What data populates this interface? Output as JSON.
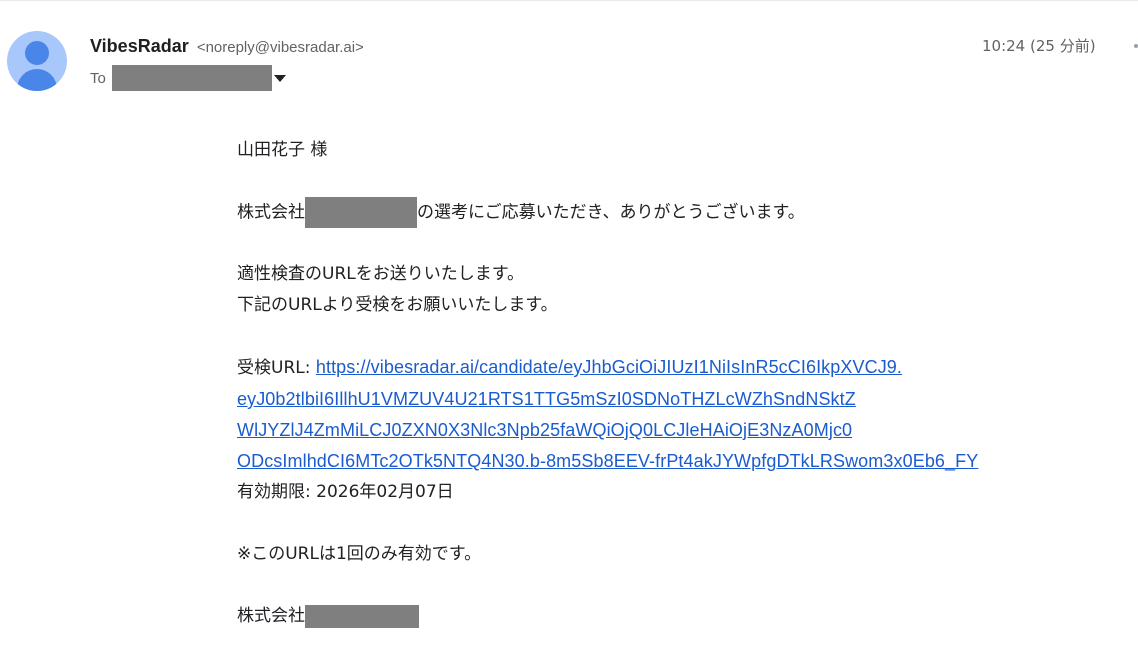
{
  "email": {
    "sender_name": "VibesRadar",
    "sender_email": "<noreply@vibesradar.ai>",
    "timestamp": "10:24 (25 分前)",
    "to_label": "To"
  },
  "body": {
    "greeting": "山田花子 様",
    "thanks_prefix": "株式会社",
    "thanks_suffix": "の選考にご応募いただき、ありがとうございます。",
    "line_url_send": "適性検査のURLをお送りいたします。",
    "line_request": "下記のURLより受検をお願いいたします。",
    "url_label": "受検URL: ",
    "url_lines": [
      "https://vibesradar.ai/candidate/eyJhbGciOiJIUzI1NiIsInR5cCI6IkpXVCJ9.",
      "eyJ0b2tlbiI6IllhU1VMZUV4U21RTS1TTG5mSzI0SDNoTHZLcWZhSndNSktZ",
      "WlJYZlJ4ZmMiLCJ0ZXN0X3Nlc3Npb25faWQiOjQ0LCJleHAiOjE3NzA0Mjc0",
      "ODcsImlhdCI6MTc2OTk5NTQ4N30.b-8m5Sb8EEV-frPt4akJYWpfgDTkLRSwom3x0Eb6_FY"
    ],
    "expiry": "有効期限: 2026年02月07日",
    "note": "※このURLは1回のみ有効です。",
    "signature_prefix": "株式会社"
  },
  "colors": {
    "link": "#1a5ccf",
    "redaction": "#7f7f7f",
    "avatar_bg": "#a8c7fa",
    "avatar_fg": "#4a86e8"
  }
}
